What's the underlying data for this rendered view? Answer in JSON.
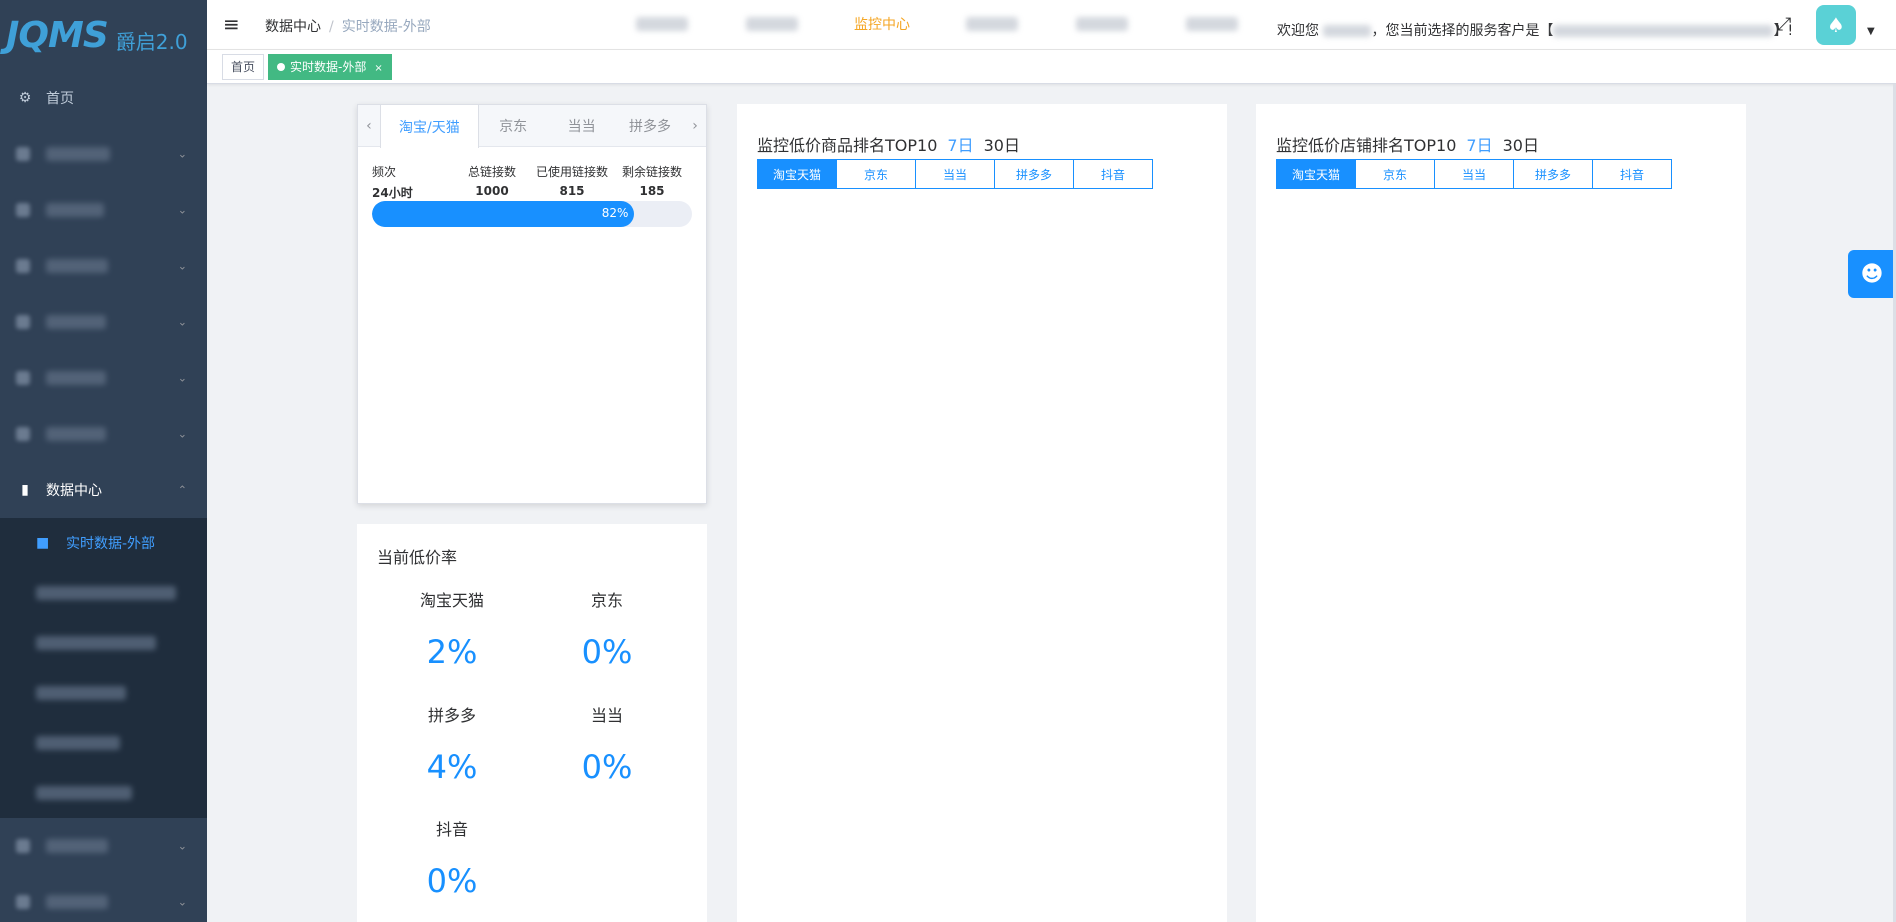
{
  "sidebar": {
    "brand": "JQMS",
    "brand_sub": "爵启2.0",
    "home_label": "首页",
    "data_center_label": "数据中心",
    "active_sub_label": "实时数据-外部"
  },
  "navbar": {
    "breadcrumb_root": "数据中心",
    "breadcrumb_sep": "/",
    "breadcrumb_current": "实时数据-外部",
    "active_nav_label": "监控中心",
    "welcome_prefix": "欢迎您",
    "welcome_middle": "，您当前选择的服务客户是【",
    "welcome_suffix": "】!"
  },
  "tags": {
    "home": "首页",
    "current": "实时数据-外部",
    "close": "×"
  },
  "stats_card": {
    "tabs": [
      "淘宝/天猫",
      "京东",
      "当当",
      "拼多多"
    ],
    "left_arrow": "‹",
    "right_arrow": "›",
    "headers": [
      "频次",
      "总链接数",
      "已使用链接数",
      "剩余链接数"
    ],
    "values": [
      "24小时",
      "1000",
      "815",
      "185"
    ],
    "progress_percent": 82,
    "progress_label": "82%"
  },
  "rate_card": {
    "title": "当前低价率",
    "items": [
      {
        "label": "淘宝天猫",
        "value": "2%"
      },
      {
        "label": "京东",
        "value": "0%"
      },
      {
        "label": "拼多多",
        "value": "4%"
      },
      {
        "label": "当当",
        "value": "0%"
      },
      {
        "label": "抖音",
        "value": "0%"
      }
    ]
  },
  "goods_rank": {
    "title": "监控低价商品排名TOP10",
    "period_7": "7日",
    "period_30": "30日",
    "platforms": [
      "淘宝天猫",
      "京东",
      "当当",
      "拼多多",
      "抖音"
    ]
  },
  "shops_rank": {
    "title": "监控低价店铺排名TOP10",
    "period_7": "7日",
    "period_30": "30日",
    "platforms": [
      "淘宝天猫",
      "京东",
      "当当",
      "拼多多",
      "抖音"
    ]
  },
  "colors": {
    "sidebar_bg": "#304156",
    "submenu_bg": "#1f2d3d",
    "accent": "#1890ff",
    "tag_active": "#42b983",
    "nav_active": "#f5a623"
  },
  "icons": {
    "hamburger": "hamburger-icon",
    "fullscreen": "fullscreen-icon",
    "user": "user-icon"
  }
}
